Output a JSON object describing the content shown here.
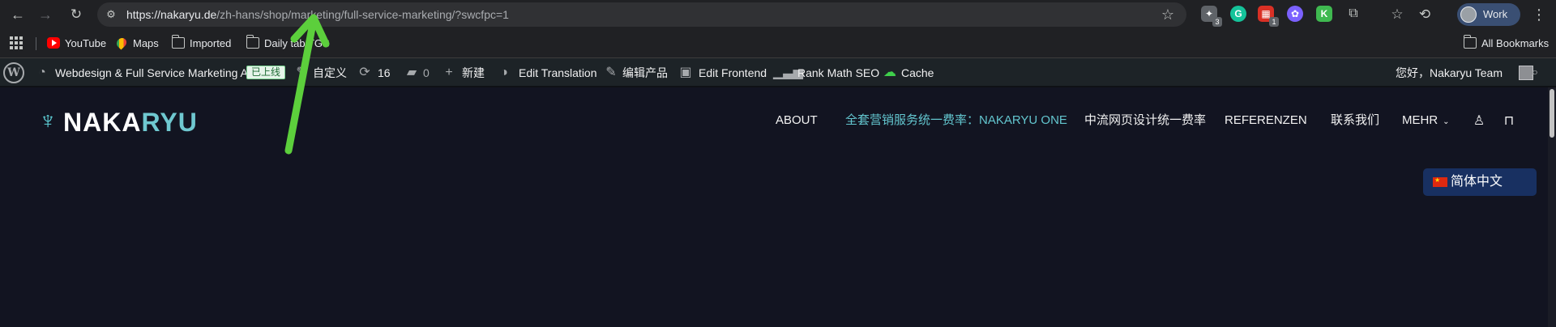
{
  "browser": {
    "url_host": "https://nakaryu.de",
    "url_path": "/zh-hans/shop/marketing/full-service-marketing/?swcfpc=1",
    "extensions": [
      {
        "name": "ext-1",
        "glyph": "✦",
        "badge": "3"
      },
      {
        "name": "grammarly",
        "glyph": "G",
        "badge": ""
      },
      {
        "name": "ext-3",
        "glyph": "▦",
        "badge": "1"
      },
      {
        "name": "ext-4",
        "glyph": "✿",
        "badge": ""
      },
      {
        "name": "ext-5",
        "glyph": "K",
        "badge": ""
      },
      {
        "name": "extensions-puzzle",
        "glyph": "⧉",
        "badge": ""
      }
    ],
    "profile_label": "Work"
  },
  "bookmarks": {
    "items": [
      {
        "label": "YouTube"
      },
      {
        "label": "Maps"
      },
      {
        "label": "Imported"
      },
      {
        "label": "Daily tab TGS"
      }
    ],
    "all_label": "All Bookmarks"
  },
  "admin_bar": {
    "site_name": "Webdesign & Full Service Marketing A...",
    "live_badge": "已上线",
    "customize": "自定义",
    "updates_count": "16",
    "comments_count": "0",
    "new": "新建",
    "edit_translation": "Edit Translation",
    "edit_product": "编辑产品",
    "edit_frontend": "Edit Frontend",
    "rank_math": "Rank Math SEO",
    "cache": "Cache",
    "greeting": "您好，Nakaryu Team"
  },
  "site": {
    "logo_main": "NAKA",
    "logo_accent": "RYU",
    "nav": [
      {
        "label": "ABOUT",
        "active": false
      },
      {
        "label": "全套营销服务统一费率：NAKARYU ONE",
        "active": true
      },
      {
        "label": "中流网页设计统一费率",
        "active": false
      },
      {
        "label": "REFERENZEN",
        "active": false
      },
      {
        "label": "联系我们",
        "active": false
      },
      {
        "label": "MEHR",
        "active": false
      }
    ],
    "language": "简体中文"
  },
  "colors": {
    "accent": "#63c6cf",
    "admin_bar_bg": "#1d2327",
    "site_bg": "#121421",
    "annotation_arrow": "#5ccf3c"
  }
}
